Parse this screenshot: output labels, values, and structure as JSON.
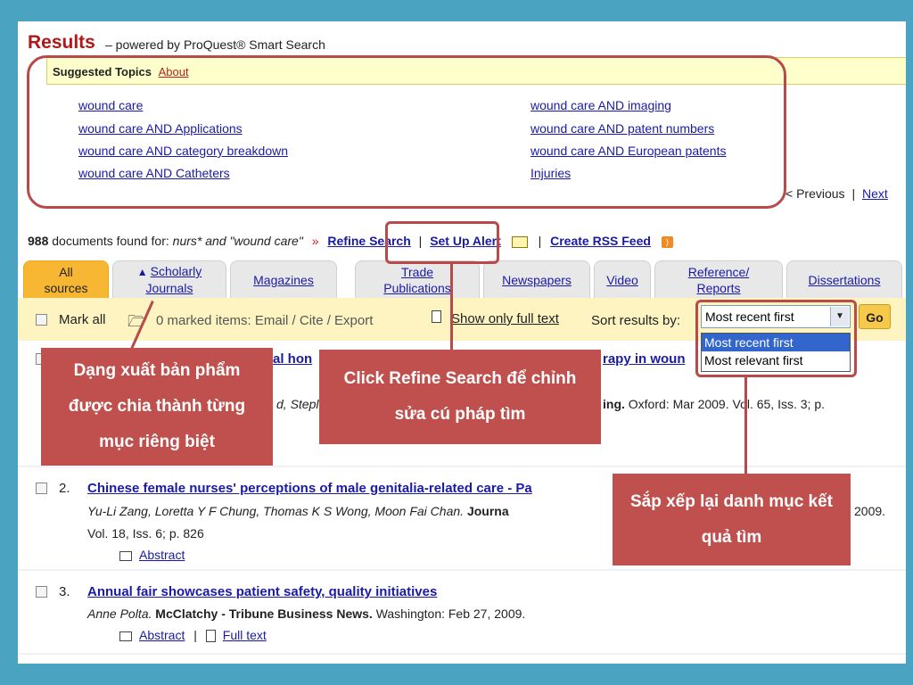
{
  "header": {
    "title": "Results",
    "powered": "– powered by ProQuest® Smart Search"
  },
  "suggested": {
    "label": "Suggested Topics",
    "about": "About",
    "left": [
      "wound care",
      "wound care AND Applications",
      "wound care AND category breakdown",
      "wound care AND Catheters"
    ],
    "right": [
      "wound care AND imaging",
      "wound care AND patent numbers",
      "wound care AND European patents",
      "Injuries"
    ],
    "previous": "< Previous",
    "separator": "|",
    "next": "Next"
  },
  "search": {
    "count": "988",
    "found_text": "documents found for:",
    "query": "nurs* and \"wound care\"",
    "arrow": "»",
    "refine": "Refine Search",
    "alert": "Set Up Alert",
    "rss": "Create RSS Feed"
  },
  "tabs": [
    {
      "l1": "All",
      "l2": "sources"
    },
    {
      "l1": "Scholarly",
      "l2": "Journals"
    },
    {
      "l1": "Magazines",
      "l2": ""
    },
    {
      "l1": "Trade",
      "l2": "Publications"
    },
    {
      "l1": "Newspapers",
      "l2": ""
    },
    {
      "l1": "Video",
      "l2": ""
    },
    {
      "l1": "Reference/",
      "l2": "Reports"
    },
    {
      "l1": "Dissertations",
      "l2": ""
    }
  ],
  "toolbar": {
    "mark_all": "Mark all",
    "marked": "0 marked items: Email / Cite / Export",
    "show_full": "Show only full text",
    "sort_label": "Sort results by:",
    "sort_value": "Most recent first",
    "go": "Go",
    "options": [
      "Most recent first",
      "Most relevant first"
    ]
  },
  "results": [
    {
      "num": "1.",
      "title_a": "al hon",
      "title_b": "rapy in woun",
      "authors": "d, Stepl",
      "source": "ing.",
      "details": "Oxford: Mar 2009. Vol. 65, Iss. 3; p."
    },
    {
      "num": "2.",
      "title": "Chinese female nurses' perceptions of male genitalia-related care - Pa",
      "authors": "Yu-Li Zang, Loretta Y F Chung, Thomas K S Wong, Moon Fai Chan.",
      "source": "Journa",
      "year_tail": "2009.",
      "line2": "Vol. 18, Iss. 6; p. 826",
      "abstract": "Abstract"
    },
    {
      "num": "3.",
      "title": "Annual fair showcases patient safety, quality initiatives",
      "authors": "Anne Polta.",
      "source": "McClatchy - Tribune Business News.",
      "details": "Washington: Feb 27, 2009.",
      "abstract": "Abstract",
      "fulltext": "Full text"
    }
  ],
  "callouts": {
    "pubtype": "Dạng xuất bản phẩm được chia thành từng mục riêng biệt",
    "refine": "Click Refine Search để chỉnh sửa cú pháp tìm",
    "sort": "Sắp xếp lại danh mục kết quả tìm"
  },
  "colors": {
    "background": "#4aa3c0",
    "accent_red": "#b94a4a",
    "callout": "#c0504d",
    "link": "#1a1aa6",
    "active_tab": "#f7b733",
    "toolbar": "#fef4c2"
  }
}
